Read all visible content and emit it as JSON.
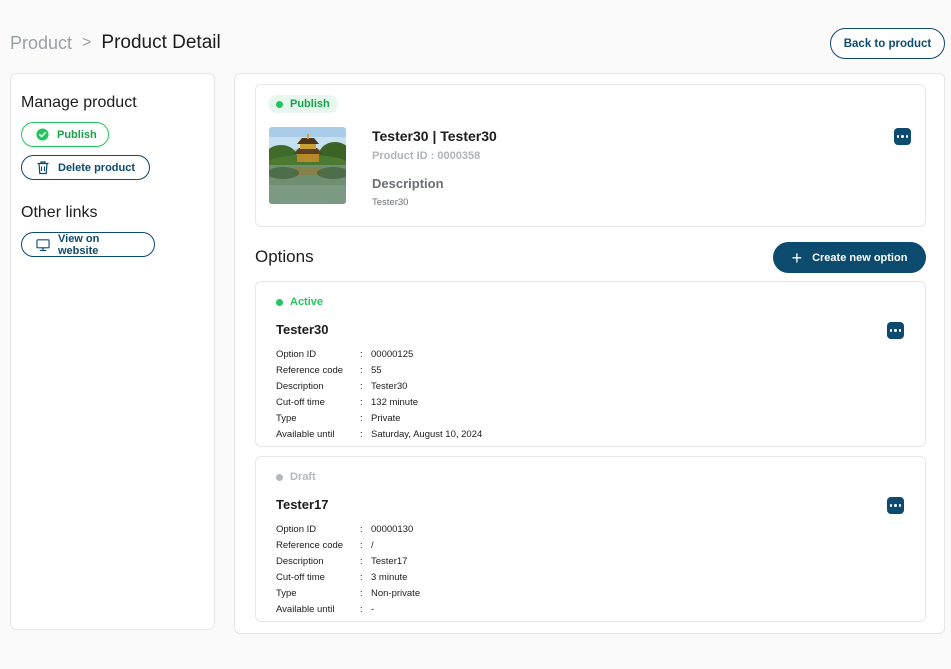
{
  "breadcrumb": {
    "parent": "Product",
    "separator": ">",
    "current": "Product Detail"
  },
  "header": {
    "back_label": "Back to product"
  },
  "sidebar": {
    "manage_title": "Manage product",
    "publish_label": "Publish",
    "delete_label": "Delete product",
    "other_title": "Other links",
    "view_label": "View on website"
  },
  "product": {
    "status": "Publish",
    "title": "Tester30 | Tester30",
    "product_id": "Product ID : 0000358",
    "description_label": "Description",
    "description": "Tester30"
  },
  "options_section": {
    "title": "Options",
    "create_label": "Create new option"
  },
  "options": [
    {
      "status": "Active",
      "name": "Tester30",
      "fields": [
        {
          "label": "Option ID",
          "value": "00000125"
        },
        {
          "label": "Reference code",
          "value": "55"
        },
        {
          "label": "Description",
          "value": "Tester30"
        },
        {
          "label": "Cut-off time",
          "value": "132 minute"
        },
        {
          "label": "Type",
          "value": "Private"
        },
        {
          "label": "Available until",
          "value": "Saturday, August 10, 2024"
        }
      ]
    },
    {
      "status": "Draft",
      "name": "Tester17",
      "fields": [
        {
          "label": "Option ID",
          "value": "00000130"
        },
        {
          "label": "Reference code",
          "value": "/"
        },
        {
          "label": "Description",
          "value": "Tester17"
        },
        {
          "label": "Cut-off time",
          "value": "3 minute"
        },
        {
          "label": "Type",
          "value": "Non-private"
        },
        {
          "label": "Available until",
          "value": "-"
        }
      ]
    }
  ],
  "separator_colon": ":",
  "icons": {
    "publish": "check-circle-icon",
    "delete": "trash-icon",
    "view": "monitor-icon",
    "more": "more-horizontal-icon",
    "create": "plus-icon"
  },
  "colors": {
    "primary": "#0c4a6e",
    "success": "#22c55e",
    "draft": "#b4b8bc"
  }
}
